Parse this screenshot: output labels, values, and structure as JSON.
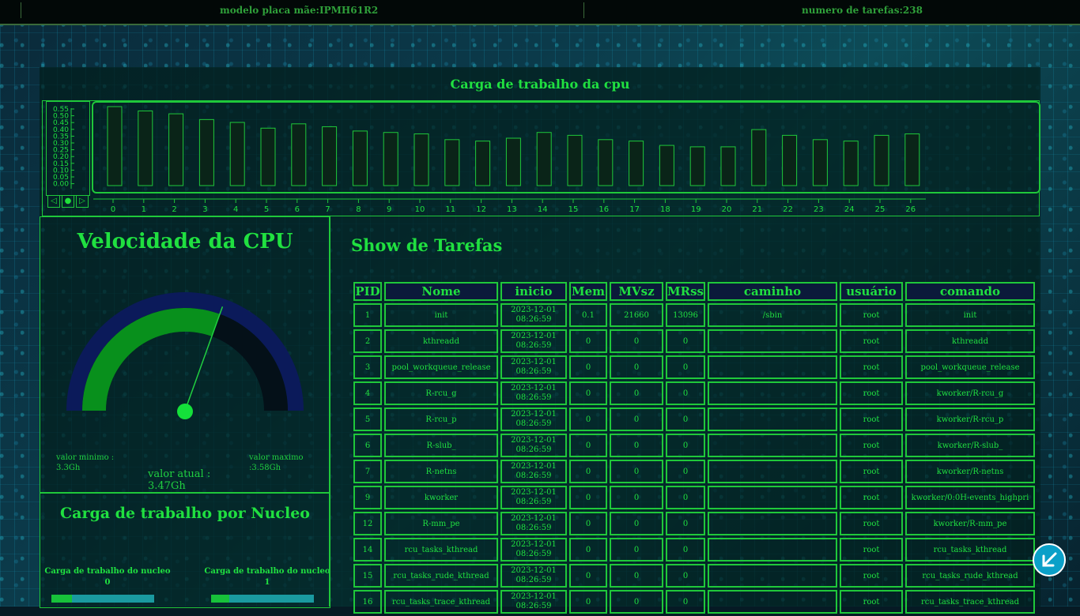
{
  "topbar": {
    "motherboard": "modelo placa mãe:IPMH61R2",
    "tasks_count": "numero de tarefas:238"
  },
  "cpu_load": {
    "title": "Carga de trabalho da cpu",
    "chart_data": {
      "type": "bar",
      "title": "",
      "xlabel": "",
      "ylabel": "",
      "ylim": [
        0,
        0.55
      ],
      "yticks": [
        "0.55",
        "0.50",
        "0.45",
        "0.40",
        "0.35",
        "0.30",
        "0.25",
        "0.20",
        "0.15",
        "0.10",
        "0.05",
        "0.00"
      ],
      "categories": [
        "0",
        "1",
        "2",
        "3",
        "4",
        "5",
        "6",
        "7",
        "8",
        "9",
        "10",
        "11",
        "12",
        "13",
        "14",
        "15",
        "16",
        "17",
        "18",
        "19",
        "20",
        "21",
        "22",
        "23",
        "24",
        "25",
        "26"
      ],
      "values": [
        0.55,
        0.52,
        0.5,
        0.46,
        0.44,
        0.4,
        0.43,
        0.41,
        0.38,
        0.37,
        0.36,
        0.32,
        0.31,
        0.33,
        0.37,
        0.35,
        0.32,
        0.31,
        0.28,
        0.27,
        0.27,
        0.39,
        0.35,
        0.32,
        0.31,
        0.35,
        0.36
      ],
      "bar_fill": "#0a2418",
      "bar_stroke": "#1fc83a"
    },
    "controls": [
      "◁",
      "●",
      "▷"
    ]
  },
  "cpu_speed": {
    "title": "Velocidade da CPU",
    "min_label": "valor minimo :",
    "min_value": "3.3Gh",
    "max_label": "valor maximo",
    "max_value": ":3.58Gh",
    "current_label": "valor atual :",
    "current_value": "3.47Gh",
    "gauge_fraction": 0.61
  },
  "cores": {
    "title": "Carga de trabalho por Nucleo",
    "items": [
      {
        "label": "Carga de trabalho do nucleo",
        "index": "0",
        "fraction": 0.2
      },
      {
        "label": "Carga de trabalho do nucleo",
        "index": "1",
        "fraction": 0.18
      }
    ]
  },
  "tasks": {
    "title": "Show de Tarefas",
    "columns": [
      "PID",
      "Nome",
      "inicio",
      "Mem",
      "MVsz",
      "MRss",
      "caminho",
      "usuário",
      "comando"
    ],
    "rows": [
      [
        "1",
        "init",
        "2023-12-01 08:26:59",
        "0.1",
        "21660",
        "13096",
        "/sbin",
        "root",
        "init"
      ],
      [
        "2",
        "kthreadd",
        "2023-12-01 08:26:59",
        "0",
        "0",
        "0",
        "",
        "root",
        "kthreadd"
      ],
      [
        "3",
        "pool_workqueue_release",
        "2023-12-01 08:26:59",
        "0",
        "0",
        "0",
        "",
        "root",
        "pool_workqueue_release"
      ],
      [
        "4",
        "R-rcu_g",
        "2023-12-01 08:26:59",
        "0",
        "0",
        "0",
        "",
        "root",
        "kworker/R-rcu_g"
      ],
      [
        "5",
        "R-rcu_p",
        "2023-12-01 08:26:59",
        "0",
        "0",
        "0",
        "",
        "root",
        "kworker/R-rcu_p"
      ],
      [
        "6",
        "R-slub_",
        "2023-12-01 08:26:59",
        "0",
        "0",
        "0",
        "",
        "root",
        "kworker/R-slub_"
      ],
      [
        "7",
        "R-netns",
        "2023-12-01 08:26:59",
        "0",
        "0",
        "0",
        "",
        "root",
        "kworker/R-netns"
      ],
      [
        "9",
        "kworker",
        "2023-12-01 08:26:59",
        "0",
        "0",
        "0",
        "",
        "root",
        "kworker/0:0H-events_highpri"
      ],
      [
        "12",
        "R-mm_pe",
        "2023-12-01 08:26:59",
        "0",
        "0",
        "0",
        "",
        "root",
        "kworker/R-mm_pe"
      ],
      [
        "14",
        "rcu_tasks_kthread",
        "2023-12-01 08:26:59",
        "0",
        "0",
        "0",
        "",
        "root",
        "rcu_tasks_kthread"
      ],
      [
        "15",
        "rcu_tasks_rude_kthread",
        "2023-12-01 08:26:59",
        "0",
        "0",
        "0",
        "",
        "root",
        "rcu_tasks_rude_kthread"
      ],
      [
        "16",
        "rcu_tasks_trace_kthread",
        "2023-12-01 08:26:59",
        "0",
        "0",
        "0",
        "",
        "root",
        "rcu_tasks_trace_kthread"
      ]
    ]
  },
  "back_button_icon": "arrow-down-left-icon",
  "colors": {
    "accent": "#1fe03a",
    "gauge_bg": "#0b1a5a",
    "gauge_fill": "#08901c",
    "back_button": "#0aa0c8"
  }
}
